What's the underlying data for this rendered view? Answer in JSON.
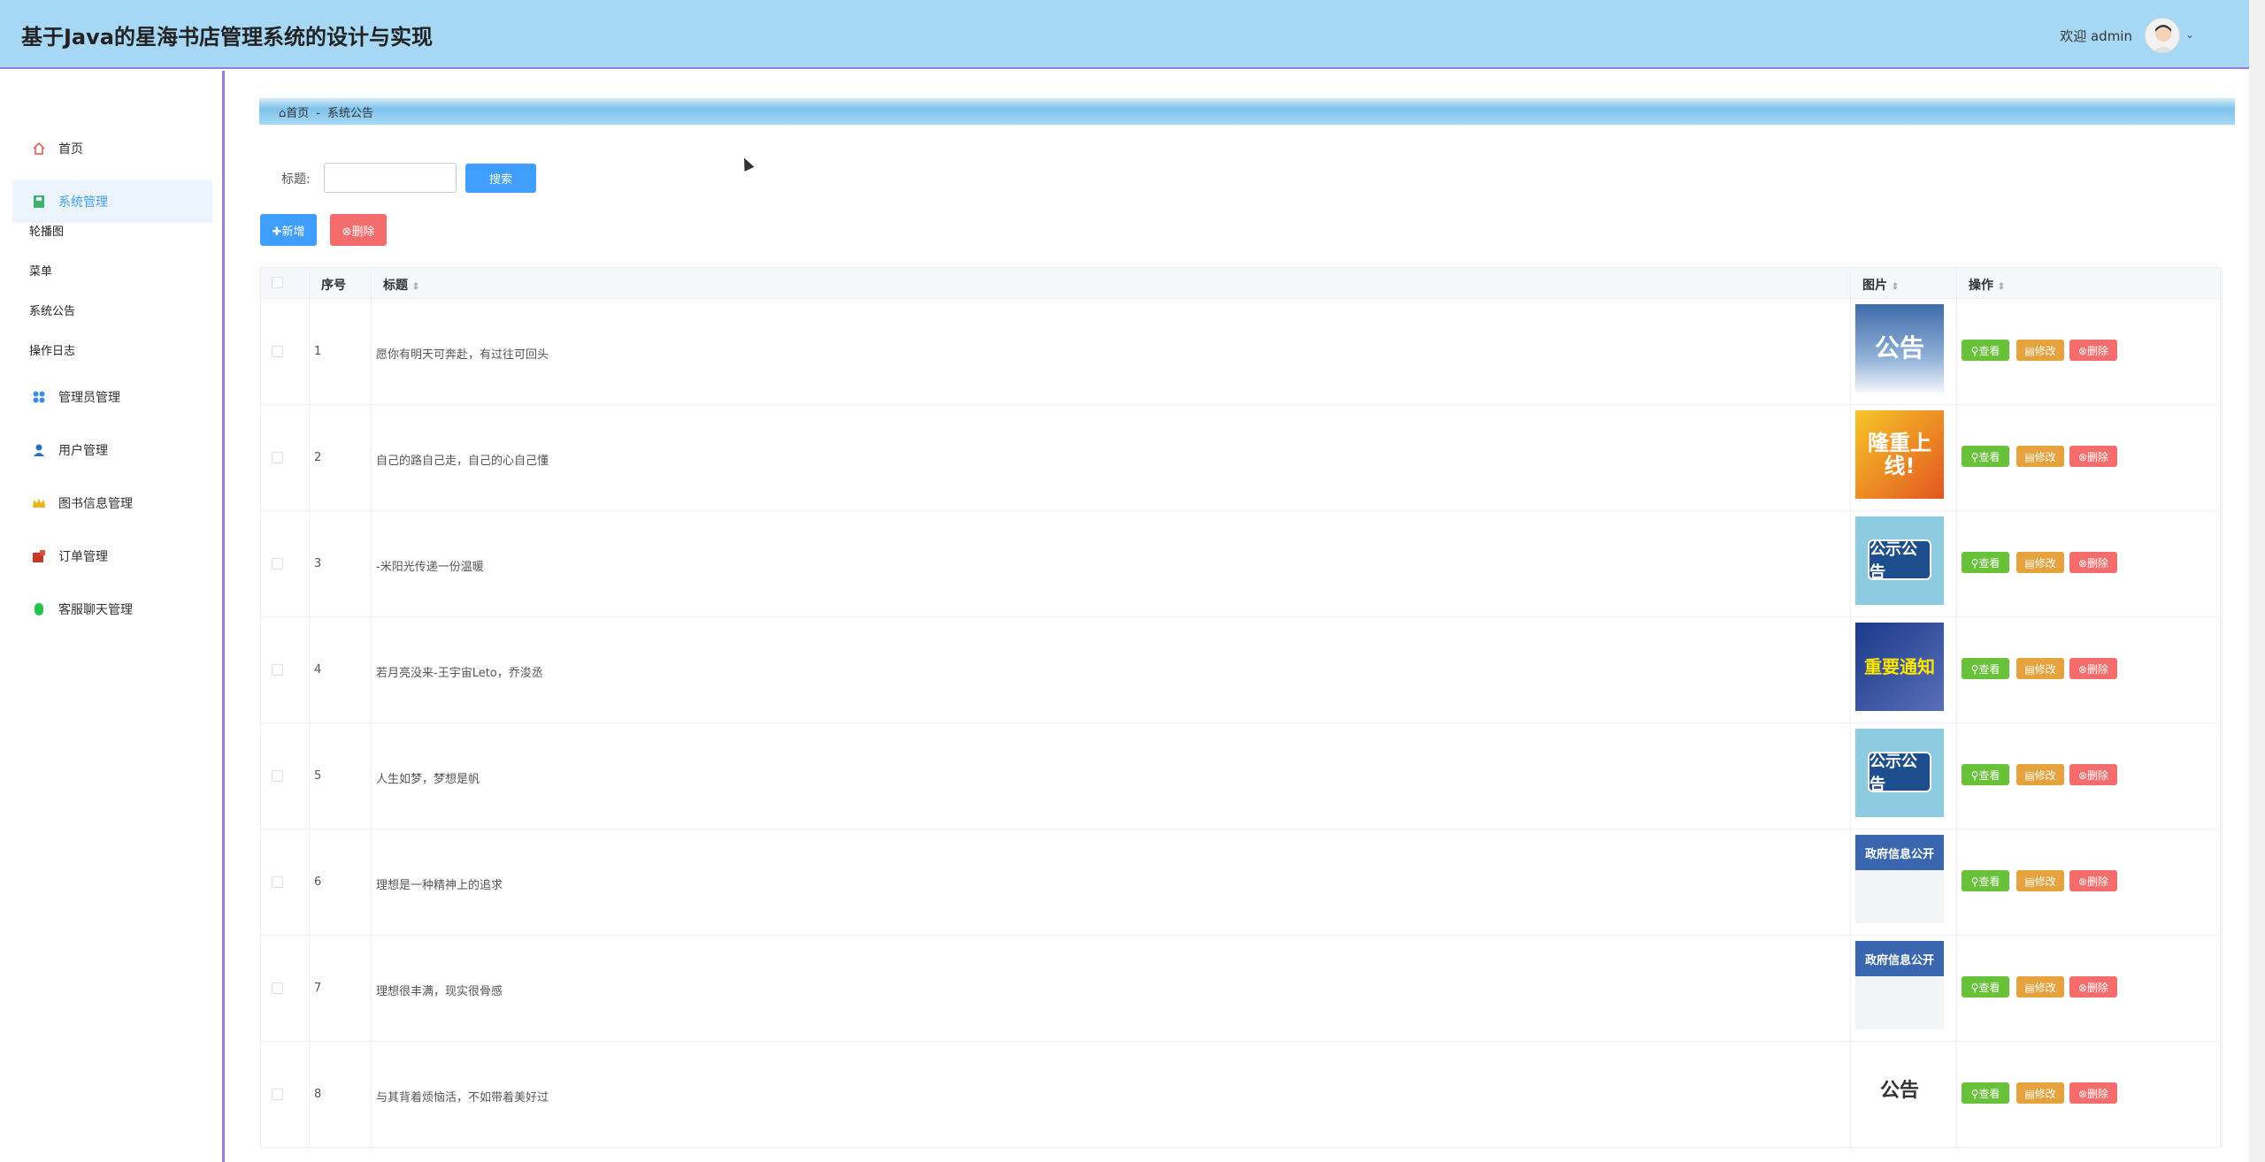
{
  "header": {
    "title": "基于Java的星海书店管理系统的设计与实现",
    "welcome": "欢迎 admin"
  },
  "sidebar": {
    "items": [
      {
        "label": "首页",
        "icon": "home-icon"
      },
      {
        "label": "系统管理",
        "icon": "book-icon"
      },
      {
        "label": "管理员管理",
        "icon": "grid-icon"
      },
      {
        "label": "用户管理",
        "icon": "user-icon"
      },
      {
        "label": "图书信息管理",
        "icon": "crown-icon"
      },
      {
        "label": "订单管理",
        "icon": "order-icon"
      },
      {
        "label": "客服聊天管理",
        "icon": "chat-icon"
      }
    ],
    "sub_items": [
      "轮播图",
      "菜单",
      "系统公告",
      "操作日志"
    ]
  },
  "breadcrumb": {
    "home": "首页",
    "current": "系统公告"
  },
  "search": {
    "label": "标题:",
    "button": "搜索",
    "value": ""
  },
  "actions": {
    "add": "新增",
    "delete": "删除"
  },
  "table": {
    "headers": {
      "index": "序号",
      "title": "标题",
      "image": "图片",
      "ops": "操作"
    },
    "ops": {
      "view": "查看",
      "edit": "修改",
      "delete": "删除"
    },
    "rows": [
      {
        "index": "1",
        "title": "愿你有明天可奔赴，有过往可回头",
        "image": "公告"
      },
      {
        "index": "2",
        "title": "自己的路自己走，自己的心自己懂",
        "image": "隆重上线!"
      },
      {
        "index": "3",
        "title": "-米阳光传递一份温暖",
        "image": "公示公告"
      },
      {
        "index": "4",
        "title": "若月亮没来-王宇宙Leto，乔浚丞",
        "image": "重要通知"
      },
      {
        "index": "5",
        "title": "人生如梦，梦想是帆",
        "image": "公示公告"
      },
      {
        "index": "6",
        "title": "理想是一种精神上的追求",
        "image": "政府信息公开"
      },
      {
        "index": "7",
        "title": "理想很丰满，现实很骨感",
        "image": "政府信息公开"
      },
      {
        "index": "8",
        "title": "与其背着烦恼活，不如带着美好过",
        "image": "公告"
      }
    ]
  },
  "colors": {
    "header_bg": "#a6d8f5",
    "primary": "#409eff",
    "success": "#67c23a",
    "warning": "#e6a23c",
    "danger": "#f56c6c"
  }
}
